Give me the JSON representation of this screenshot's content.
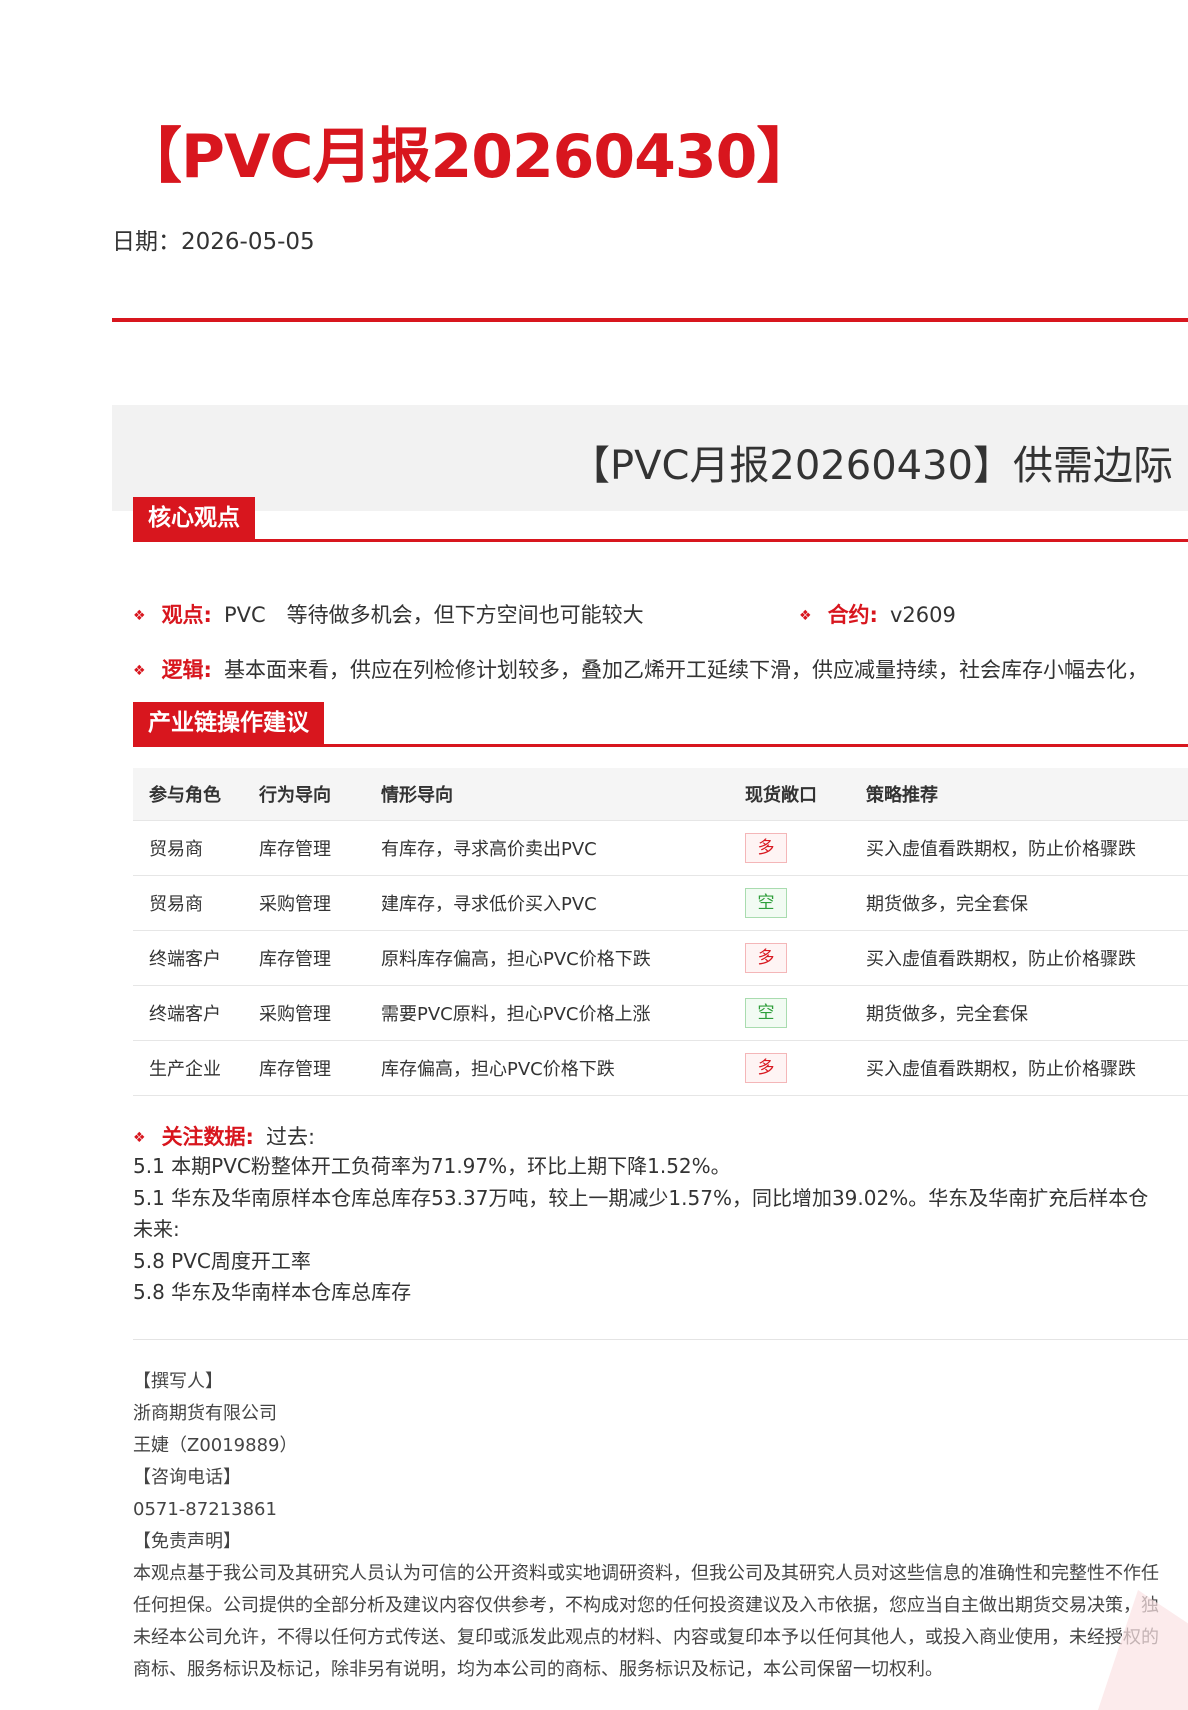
{
  "title": "【PVC月报20260430】",
  "date_line": "日期：2026-05-05",
  "banner_title": "【PVC月报20260430】供需边际",
  "core": {
    "header": "核心观点",
    "view_label": "观点:",
    "view_text": "PVC　等待做多机会，但下方空间也可能较大",
    "contract_label": "合约:",
    "contract_text": "v2609",
    "logic_label": "逻辑:",
    "logic_text": "基本面来看，供应在列检修计划较多，叠加乙烯开工延续下滑，供应减量持续，社会库存小幅去化，"
  },
  "industry": {
    "header": "产业链操作建议",
    "columns": [
      "参与角色",
      "行为导向",
      "情形导向",
      "现货敞口",
      "策略推荐"
    ],
    "rows": [
      {
        "role": "贸易商",
        "behavior": "库存管理",
        "situation": "有库存，寻求高价卖出PVC",
        "exposure": "多",
        "exposure_type": "long",
        "strategy": "买入虚值看跌期权，防止价格骤跌"
      },
      {
        "role": "贸易商",
        "behavior": "采购管理",
        "situation": "建库存，寻求低价买入PVC",
        "exposure": "空",
        "exposure_type": "short",
        "strategy": "期货做多，完全套保"
      },
      {
        "role": "终端客户",
        "behavior": "库存管理",
        "situation": "原料库存偏高，担心PVC价格下跌",
        "exposure": "多",
        "exposure_type": "long",
        "strategy": "买入虚值看跌期权，防止价格骤跌"
      },
      {
        "role": "终端客户",
        "behavior": "采购管理",
        "situation": "需要PVC原料，担心PVC价格上涨",
        "exposure": "空",
        "exposure_type": "short",
        "strategy": "期货做多，完全套保"
      },
      {
        "role": "生产企业",
        "behavior": "库存管理",
        "situation": "库存偏高，担心PVC价格下跌",
        "exposure": "多",
        "exposure_type": "long",
        "strategy": "买入虚值看跌期权，防止价格骤跌"
      }
    ]
  },
  "focus": {
    "label": "关注数据:",
    "past_label": "过去:",
    "past_items": [
      "5.1 本期PVC粉整体开工负荷率为71.97%，环比上期下降1.52%。",
      "5.1 华东及华南原样本仓库总库存53.37万吨，较上一期减少1.57%，同比增加39.02%。华东及华南扩充后样本仓"
    ],
    "future_label": "未来:",
    "future_items": [
      "5.8 PVC周度开工率",
      "5.8 华东及华南样本仓库总库存"
    ]
  },
  "footer": {
    "lines": [
      "【撰写人】",
      "浙商期货有限公司",
      "王婕（Z0019889）",
      "【咨询电话】",
      "0571-87213861",
      "【免责声明】",
      "本观点基于我公司及其研究人员认为可信的公开资料或实地调研资料，但我公司及其研究人员对这些信息的准确性和完整性不作任",
      "任何担保。公司提供的全部分析及建议内容仅供参考，不构成对您的任何投资建议及入市依据，您应当自主做出期货交易决策，独",
      "未经本公司允许，不得以任何方式传送、复印或派发此观点的材料、内容或复印本予以任何其他人，或投入商业使用，未经授权的",
      "商标、服务标识及标记，除非另有说明，均为本公司的商标、服务标识及标记，本公司保留一切权利。"
    ]
  },
  "colors": {
    "brand_red": "#d8161e",
    "long_red": "#d8161e",
    "short_green": "#2e9e3a",
    "banner_bg": "#f2f2f2"
  }
}
